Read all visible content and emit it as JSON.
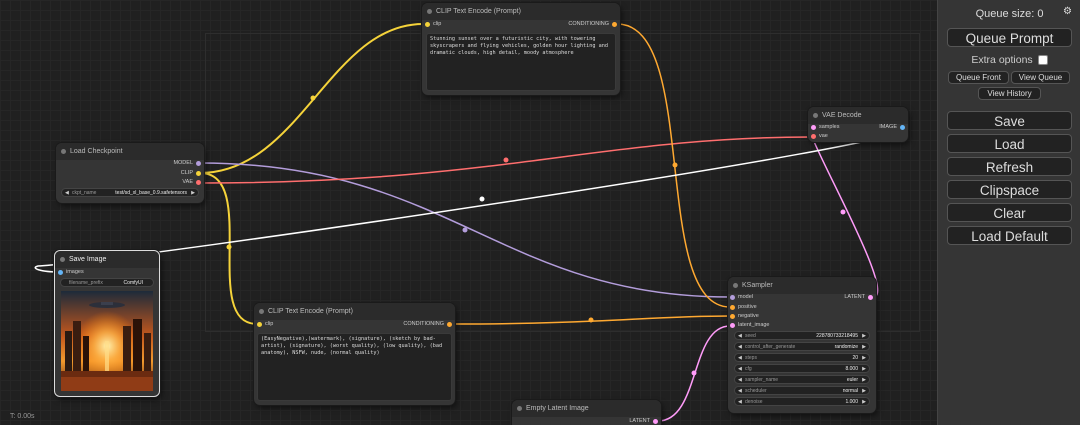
{
  "panel": {
    "queue_size": "Queue size: 0",
    "queue_prompt": "Queue Prompt",
    "extra_options": "Extra options",
    "queue_front": "Queue Front",
    "view_queue": "View Queue",
    "view_history": "View History",
    "save": "Save",
    "load": "Load",
    "refresh": "Refresh",
    "clipspace": "Clipspace",
    "clear": "Clear",
    "load_default": "Load Default",
    "settings_icon": "gear-icon"
  },
  "status": {
    "time": "T: 0.00s"
  },
  "nodes": {
    "clip_pos": {
      "title": "CLIP Text Encode (Prompt)",
      "input": "clip",
      "output": "CONDITIONING",
      "text": "Stunning sunset over a futuristic city, with towering skyscrapers and flying vehicles, golden hour lighting and dramatic clouds, high detail, moody atmosphere"
    },
    "clip_neg": {
      "title": "CLIP Text Encode (Prompt)",
      "input": "clip",
      "output": "CONDITIONING",
      "text": "(EasyNegative),(watermark), (signature), (sketch by bad-artist), (signature), (worst quality), (low quality), (bad anatomy), NSFW, nude, (normal quality)"
    },
    "checkpoint": {
      "title": "Load Checkpoint",
      "outputs": [
        "MODEL",
        "CLIP",
        "VAE"
      ],
      "widget_label": "ckpt_name",
      "widget_value": "test/sd_xl_base_0.9.safetensors"
    },
    "vae_decode": {
      "title": "VAE Decode",
      "inputs": [
        "samples",
        "vae"
      ],
      "output": "IMAGE"
    },
    "save_image": {
      "title": "Save Image",
      "input": "images",
      "widget_label": "filename_prefix",
      "widget_value": "ComfyUI"
    },
    "ksampler": {
      "title": "KSampler",
      "inputs": [
        "model",
        "positive",
        "negative",
        "latent_image"
      ],
      "output": "LATENT",
      "widgets": [
        {
          "label": "seed",
          "value": "228780733218495"
        },
        {
          "label": "control_after_generate",
          "value": "randomize"
        },
        {
          "label": "steps",
          "value": "20"
        },
        {
          "label": "cfg",
          "value": "8.000"
        },
        {
          "label": "sampler_name",
          "value": "euler"
        },
        {
          "label": "scheduler",
          "value": "normal"
        },
        {
          "label": "denoise",
          "value": "1.000"
        }
      ]
    },
    "empty_latent": {
      "title": "Empty Latent Image",
      "output": "LATENT"
    }
  },
  "colors": {
    "clip": "#f5d33a",
    "model": "#b39ddb",
    "vae": "#ff6e6e",
    "conditioning": "#ffa931",
    "latent": "#ff9cf9",
    "image": "#ffffff"
  }
}
